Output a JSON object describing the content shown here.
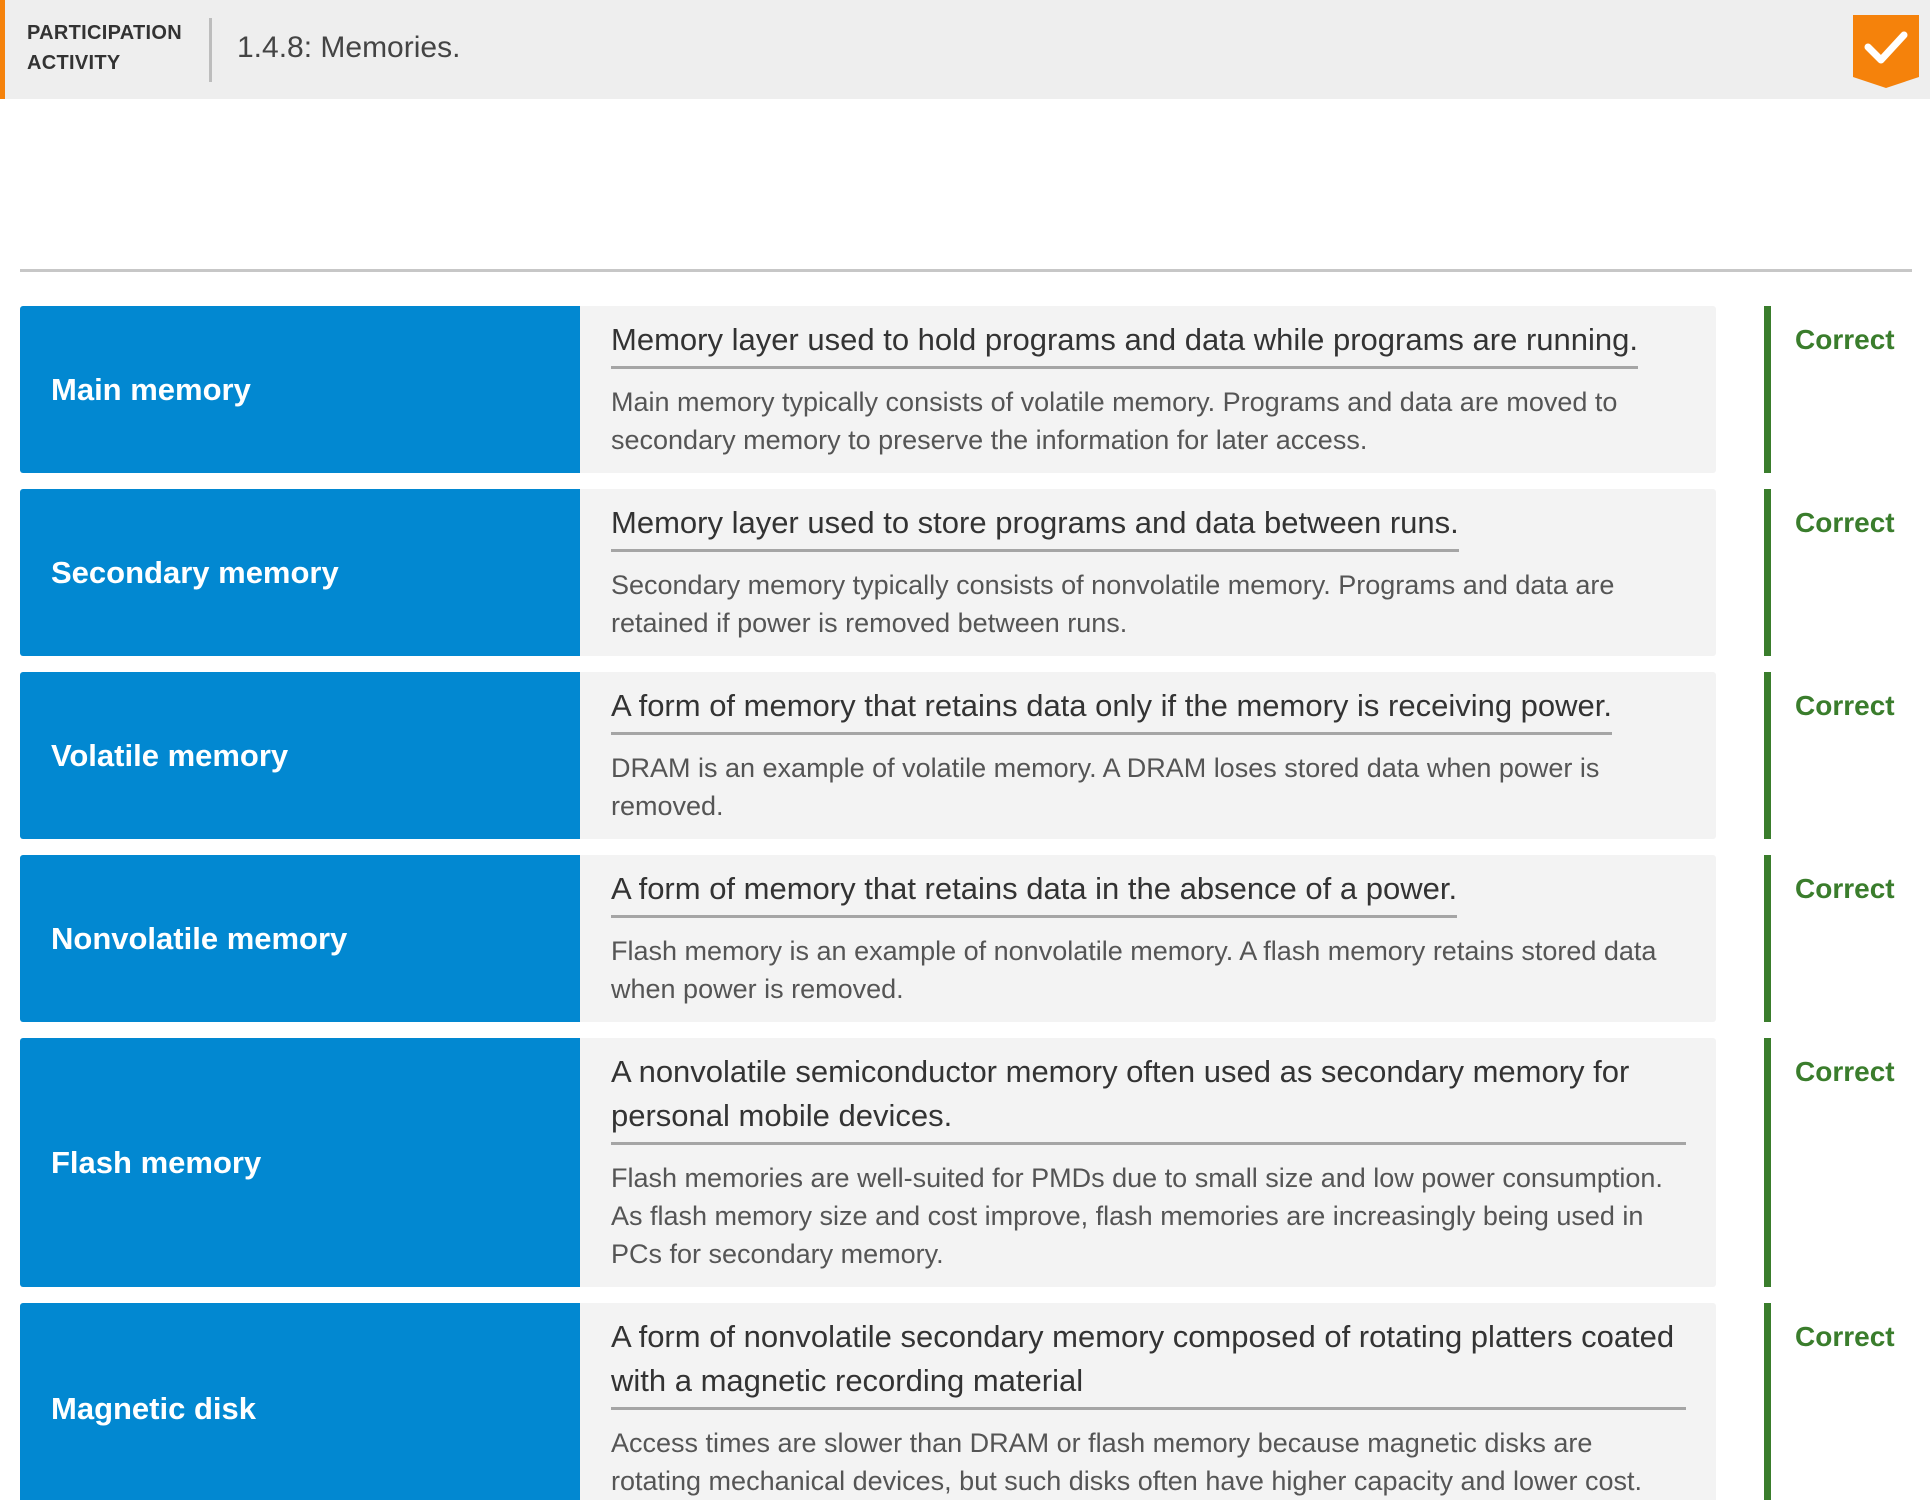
{
  "header": {
    "activity_type_line1": "PARTICIPATION",
    "activity_type_line2": "ACTIVITY",
    "title": "1.4.8: Memories.",
    "badge_icon": "checkmark-icon",
    "accent_color": "#f5820b"
  },
  "colors": {
    "term_bg": "#0288d1",
    "correct": "#3a7d2c"
  },
  "rows": [
    {
      "term": "Main memory",
      "definition": "Memory layer used to hold programs and data while programs are running.",
      "explanation": "Main memory typically consists of volatile memory. Programs and data are moved to secondary memory to preserve the information for later access.",
      "feedback": "Correct"
    },
    {
      "term": "Secondary memory",
      "definition": "Memory layer used to store programs and data between runs.",
      "explanation": "Secondary memory typically consists of nonvolatile memory. Programs and data are retained if power is removed between runs.",
      "feedback": "Correct"
    },
    {
      "term": "Volatile memory",
      "definition": "A form of memory that retains data only if the memory is receiving power.",
      "explanation": "DRAM is an example of volatile memory. A DRAM loses stored data when power is removed.",
      "feedback": "Correct"
    },
    {
      "term": "Nonvolatile memory",
      "definition": "A form of memory that retains data in the absence of a power.",
      "explanation": "Flash memory is an example of nonvolatile memory. A flash memory retains stored data when power is removed.",
      "feedback": "Correct"
    },
    {
      "term": "Flash memory",
      "definition": "A nonvolatile semiconductor memory often used as secondary memory for personal mobile devices.",
      "explanation": "Flash memories are well-suited for PMDs due to small size and low power consumption. As flash memory size and cost improve, flash memories are increasingly being used in PCs for secondary memory.",
      "feedback": "Correct"
    },
    {
      "term": "Magnetic disk",
      "definition": "A form of nonvolatile secondary memory composed of rotating platters coated with a magnetic recording material",
      "explanation": "Access times are slower than DRAM or flash memory because magnetic disks are rotating mechanical devices, but such disks often have higher capacity and lower cost.",
      "feedback": "Correct"
    }
  ]
}
